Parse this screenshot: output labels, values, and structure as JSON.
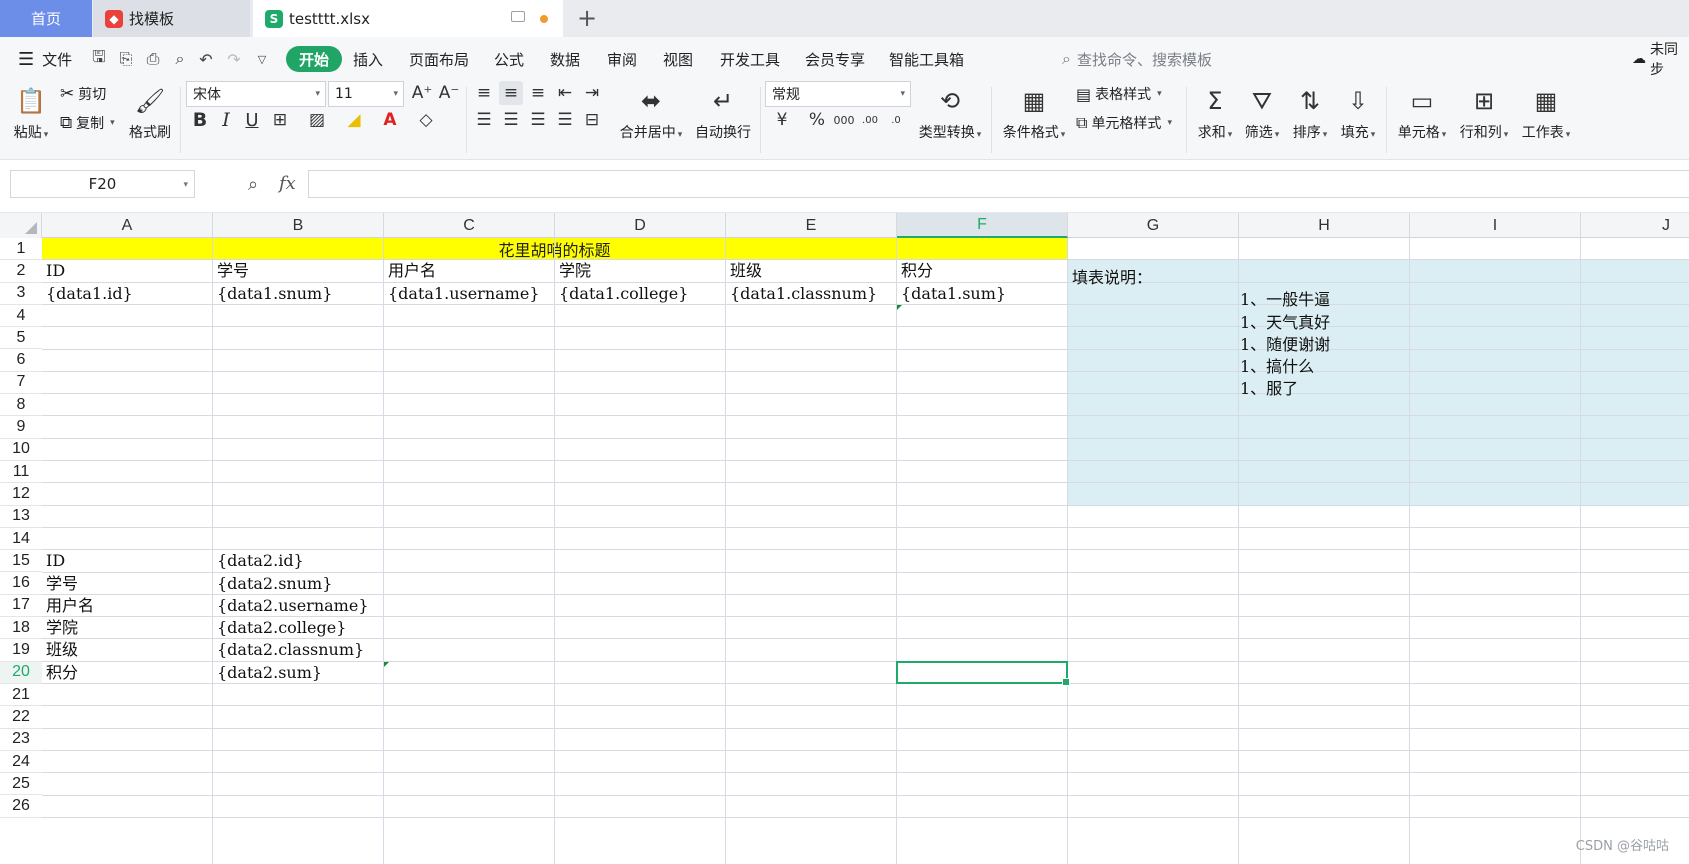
{
  "tabs": {
    "home": "首页",
    "template": "找模板",
    "file": "testttt.xlsx",
    "new_tab": "+"
  },
  "menu": {
    "file": "文件",
    "items": [
      "开始",
      "插入",
      "页面布局",
      "公式",
      "数据",
      "审阅",
      "视图",
      "开发工具",
      "会员专享",
      "智能工具箱"
    ],
    "search_placeholder": "查找命令、搜索模板",
    "cloud": "未同步"
  },
  "ribbon": {
    "paste": "粘贴",
    "cut": "剪切",
    "copy": "复制",
    "format_painter": "格式刷",
    "font_name": "宋体",
    "font_size": "11",
    "merge_center": "合并居中",
    "wrap_text": "自动换行",
    "number_format": "常规",
    "type_convert": "类型转换",
    "cond_format": "条件格式",
    "table_style": "表格样式",
    "cell_style": "单元格样式",
    "sum": "求和",
    "filter": "筛选",
    "sort": "排序",
    "fill": "填充",
    "cell": "单元格",
    "row_col": "行和列",
    "worksheet": "工作表"
  },
  "formula_bar": {
    "cell_ref": "F20",
    "fx": "fx",
    "content": ""
  },
  "sheet": {
    "columns": [
      "A",
      "B",
      "C",
      "D",
      "E",
      "F",
      "G",
      "H",
      "I",
      "J"
    ],
    "active_column": "F",
    "active_row": 20,
    "rows": 26,
    "title": "花里胡哨的标题",
    "header_row": [
      "ID",
      "学号",
      "用户名",
      "学院",
      "班级",
      "积分"
    ],
    "data1_row": [
      "{data1.id}",
      "{data1.snum}",
      "{data1.username}",
      "{data1.college}",
      "{data1.classnum}",
      "{data1.sum}"
    ],
    "vertical_labels": [
      "ID",
      "学号",
      "用户名",
      "学院",
      "班级",
      "积分"
    ],
    "vertical_values": [
      "{data2.id}",
      "{data2.snum}",
      "{data2.username}",
      "{data2.college}",
      "{data2.classnum}",
      "{data2.sum}"
    ],
    "note_title": "填表说明：",
    "note_lines": [
      "1、一般牛逼",
      "1、天气真好",
      "1、随便谢谢",
      "1、搞什么",
      "1、服了"
    ]
  },
  "colors": {
    "accent": "#1eaa6a",
    "title_fill": "#ffff00",
    "note_fill": "#dbeef3",
    "home_tab": "#6d8ee8"
  },
  "watermark": "CSDN @谷咕咕"
}
